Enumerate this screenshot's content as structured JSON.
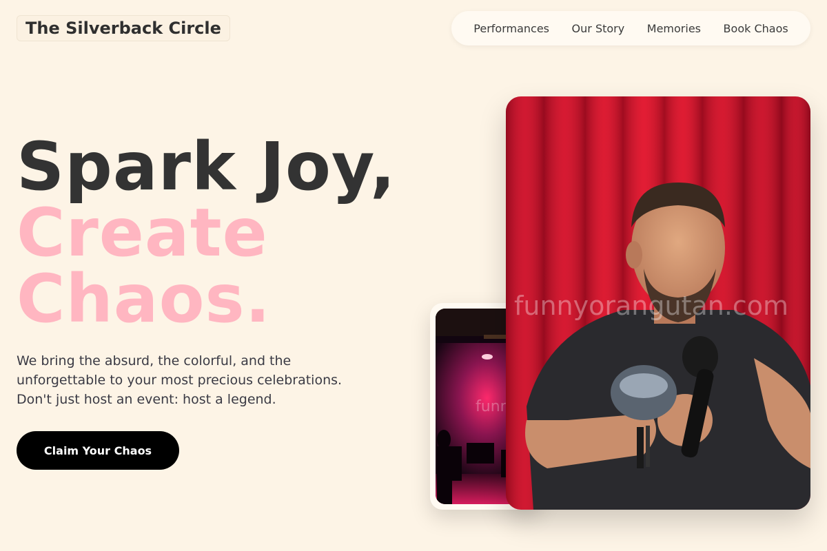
{
  "brand": {
    "name": "The Silverback Circle"
  },
  "nav": {
    "items": [
      {
        "label": "Performances"
      },
      {
        "label": "Our Story"
      },
      {
        "label": "Memories"
      },
      {
        "label": "Book Chaos"
      }
    ]
  },
  "hero": {
    "headline_line1": "Spark Joy,",
    "headline_line2": "Create",
    "headline_line3": "Chaos.",
    "subtext_line1": "We bring the absurd, the colorful, and the",
    "subtext_line2": "unforgettable to your most precious celebrations.",
    "subtext_line3": "Don't just host an event: host a legend.",
    "cta_label": "Claim Your Chaos"
  },
  "photos": {
    "main_watermark": "funnyorangutan.com",
    "small_watermark": "funny"
  },
  "colors": {
    "background": "#fdf4e6",
    "accent_pink": "#ffb6c1",
    "text_dark": "#333333",
    "cta_bg": "#000000"
  }
}
